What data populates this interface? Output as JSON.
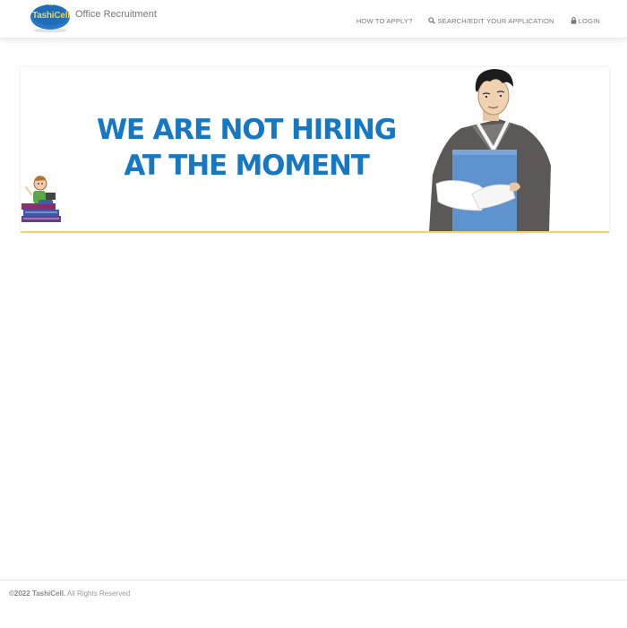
{
  "header": {
    "logo_text": "TashiCell",
    "title": "Office Recruitment",
    "nav": [
      {
        "label": "HOW TO APPLY?",
        "icon": "none"
      },
      {
        "label": "SEARCH/EDIT YOUR APPLICATION",
        "icon": "search-icon"
      },
      {
        "label": "LOGIN",
        "icon": "lock-icon"
      }
    ]
  },
  "banner": {
    "line1": "WE ARE NOT HIRING",
    "line2": "AT THE MOMENT"
  },
  "footer": {
    "year": "©2022",
    "company": "TashiCell.",
    "rights": " All Rights Reserved"
  },
  "colors": {
    "headline": "#1677c3",
    "logo_bg": "#1e6db6",
    "logo_text": "#f4d64a",
    "accent_line": "#f1d667"
  }
}
